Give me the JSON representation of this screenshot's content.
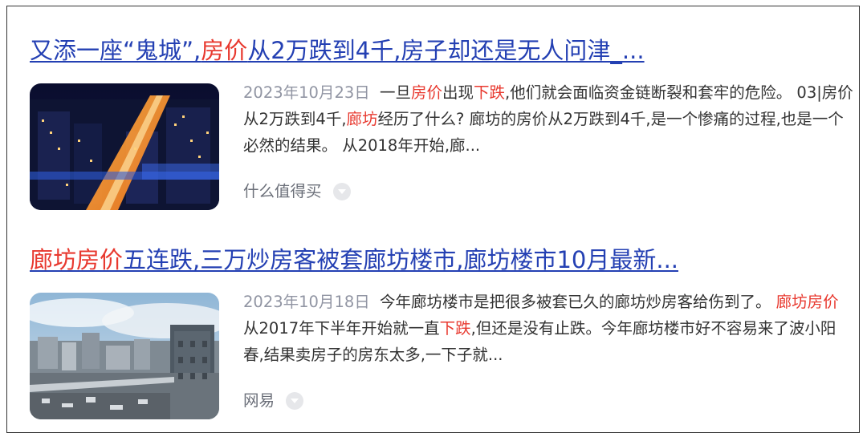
{
  "results": [
    {
      "title_parts": [
        {
          "text": "又添一座“鬼城”,",
          "hl": false
        },
        {
          "text": "房价",
          "hl": true
        },
        {
          "text": "从2万跌到4千,房子却还是无人问津_...",
          "hl": false
        }
      ],
      "date": "2023年10月23日",
      "snippet_parts": [
        {
          "text": "一旦",
          "hl": false
        },
        {
          "text": "房价",
          "hl": true
        },
        {
          "text": "出现",
          "hl": false
        },
        {
          "text": "下跌",
          "hl": true
        },
        {
          "text": ",他们就会面临资金链断裂和套牢的危险。 03|房价从2万跌到4千,",
          "hl": false
        },
        {
          "text": "廊坊",
          "hl": true
        },
        {
          "text": "经历了什么? 廊坊的房价从2万跌到4千,是一个惨痛的过程,也是一个必然的结果。 从2018年开始,廊...",
          "hl": false
        }
      ],
      "source": "什么值得买",
      "thumb_icon": "night-city-aerial-image"
    },
    {
      "title_parts": [
        {
          "text": "廊坊房价",
          "hl": true
        },
        {
          "text": "五连跌,三万炒房客被套廊坊楼市,廊坊楼市10月最新...",
          "hl": false
        }
      ],
      "date": "2023年10月18日",
      "snippet_parts": [
        {
          "text": "今年廊坊楼市是把很多被套已久的廊坊炒房客给伤到了。 ",
          "hl": false
        },
        {
          "text": "廊坊房价",
          "hl": true
        },
        {
          "text": "从2017年下半年开始就一直",
          "hl": false
        },
        {
          "text": "下跌",
          "hl": true
        },
        {
          "text": ",但还是没有止跌。今年廊坊楼市好不容易来了波小阳春,结果卖房子的房东太多,一下子就...",
          "hl": false
        }
      ],
      "source": "网易",
      "thumb_icon": "daytime-city-skyline-image"
    }
  ],
  "colors": {
    "title": "#2440b3",
    "highlight": "#e8392f",
    "date": "#9195a3",
    "source": "#6b6f79"
  }
}
